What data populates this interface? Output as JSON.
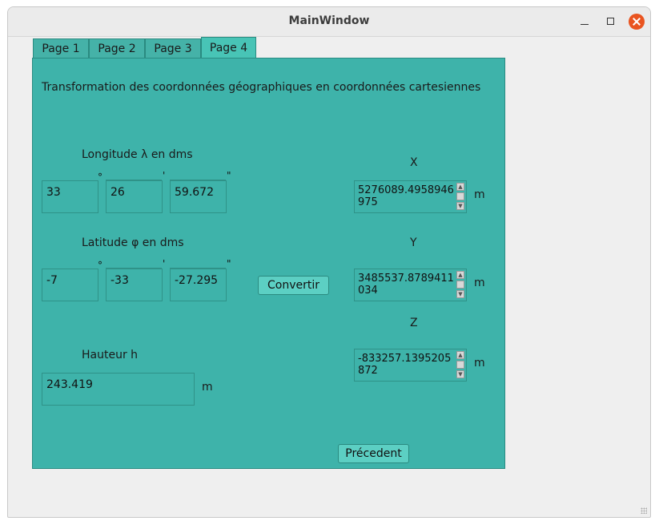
{
  "window": {
    "title": "MainWindow"
  },
  "tabs": [
    "Page 1",
    "Page 2",
    "Page 3",
    "Page 4"
  ],
  "active_tab": "Page 4",
  "heading": "Transformation des coordonnées géographiques en coordonnées cartesiennes",
  "longitude": {
    "label": "Longitude λ   en dms",
    "degrees": "33",
    "minutes": "26",
    "seconds": "59.672"
  },
  "latitude": {
    "label": "Latitude φ  en dms",
    "degrees": "-7",
    "minutes": "-33",
    "seconds": "-27.295"
  },
  "height": {
    "label": "Hauteur h",
    "value": "243.419",
    "unit": "m"
  },
  "symbols": {
    "degree": "°",
    "minute": "'",
    "second": "\""
  },
  "convert_button": "Convertir",
  "previous_button": "Précedent",
  "outputs": {
    "x": {
      "label": "X",
      "value": "5276089.4958946975",
      "unit": "m"
    },
    "y": {
      "label": "Y",
      "value": "3485537.8789411034",
      "unit": "m"
    },
    "z": {
      "label": "Z",
      "value": "-833257.1395205872",
      "unit": "m"
    }
  },
  "colors": {
    "panel": "#3eb3aa",
    "tab": "#45b2a8",
    "close": "#e95420"
  }
}
